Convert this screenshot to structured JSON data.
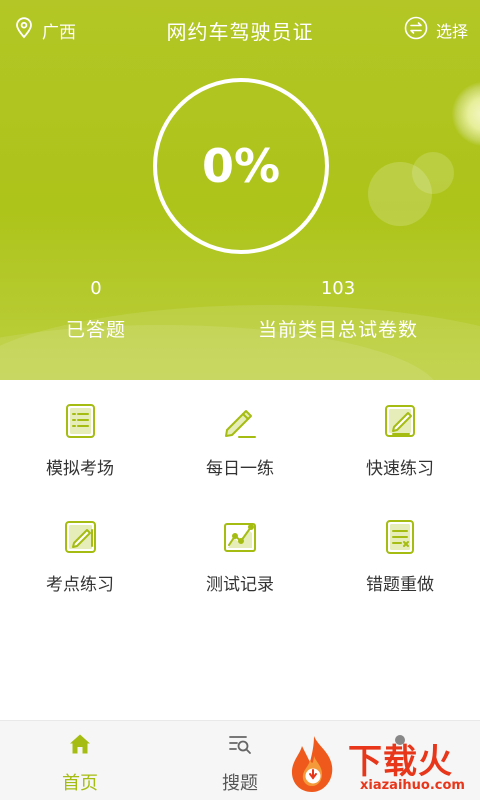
{
  "header": {
    "location": "广西",
    "title": "网约车驾驶员证",
    "switch_label": "选择"
  },
  "progress": {
    "percent_text": "0%",
    "percent": 0
  },
  "stats": {
    "answered_count": "0",
    "answered_label": "已答题",
    "total_count": "103",
    "total_label": "当前类目总试卷数"
  },
  "menu": [
    {
      "label": "模拟考场",
      "icon": "notebook-list-icon"
    },
    {
      "label": "每日一练",
      "icon": "pencil-icon"
    },
    {
      "label": "快速练习",
      "icon": "edit-note-icon"
    },
    {
      "label": "考点练习",
      "icon": "tablet-pen-icon"
    },
    {
      "label": "测试记录",
      "icon": "line-chart-icon"
    },
    {
      "label": "错题重做",
      "icon": "doc-x-icon"
    }
  ],
  "nav": {
    "home_label": "首页",
    "search_label": "搜题"
  },
  "watermark": {
    "brand": "下载火",
    "domain": "xiazaihuo.com"
  },
  "colors": {
    "accent": "#a5bd12",
    "hero": "#b3c625",
    "watermark": "#e8361a"
  }
}
